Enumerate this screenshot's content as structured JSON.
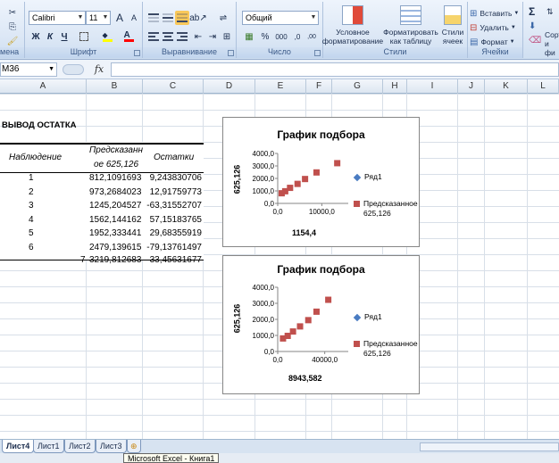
{
  "ribbon": {
    "font_group": {
      "label": "Шрифт",
      "font_name": "Calibri",
      "font_size": "11",
      "bold": "Ж",
      "italic": "К",
      "underline": "Ч",
      "grow": "A",
      "shrink": "A"
    },
    "clipboard_group": {
      "label": "мена"
    },
    "align_group": {
      "label": "Выравнивание"
    },
    "number_group": {
      "label": "Число",
      "format": "Общий",
      "percent": "%",
      "thousands": "000",
      "inc_dec": ",0",
      "dec_dec": ",00"
    },
    "styles_group": {
      "label": "Стили",
      "conditional": "Условное",
      "conditional2": "форматирование",
      "table": "Форматировать",
      "table2": "как таблицу",
      "cell_styles": "Стили",
      "cell_styles2": "ячеек"
    },
    "cells_group": {
      "label": "Ячейки",
      "insert": "Вставить",
      "delete": "Удалить",
      "format": "Формат"
    },
    "edit_group": {
      "sigma": "Σ",
      "sort": "Сорт",
      "sort2": "и фи"
    }
  },
  "formula_bar": {
    "name_box": "M36",
    "fx": "fx",
    "value": ""
  },
  "columns": [
    "A",
    "B",
    "C",
    "D",
    "E",
    "F",
    "G",
    "H",
    "I",
    "J",
    "K",
    "L"
  ],
  "table": {
    "title": "ВЫВОД ОСТАТКА",
    "headers": {
      "obs": "Наблюдение",
      "pred1": "Предсказанн",
      "pred2": "ое 625,126",
      "resid": "Остатки"
    },
    "rows": [
      {
        "n": "1",
        "pred": "812,1091693",
        "resid": "9,243830706"
      },
      {
        "n": "2",
        "pred": "973,2684023",
        "resid": "12,91759773"
      },
      {
        "n": "3",
        "pred": "1245,204527",
        "resid": "-63,31552707"
      },
      {
        "n": "4",
        "pred": "1562,144162",
        "resid": "57,15183765"
      },
      {
        "n": "5",
        "pred": "1952,333441",
        "resid": "29,68355919"
      },
      {
        "n": "6",
        "pred": "2479,139615",
        "resid": "-79,13761497"
      },
      {
        "n": "7",
        "pred": "3219,812683",
        "resid": "33,45631677"
      }
    ]
  },
  "chart_data": [
    {
      "type": "scatter",
      "title": "График подбора",
      "xlabel": "1154,4",
      "ylabel": "625,126",
      "x_ticks": [
        "0,0",
        "10000,0"
      ],
      "y_ticks": [
        "0,0",
        "1000,0",
        "2000,0",
        "3000,0",
        "4000,0"
      ],
      "ylim": [
        0,
        4000
      ],
      "xlim": [
        0,
        16000
      ],
      "legend_position": "right",
      "series": [
        {
          "name": "Ряд1",
          "color": "#4a7cc2",
          "marker": "diamond",
          "x": [],
          "y": []
        },
        {
          "name": "Предсказанное 625,126",
          "color": "#c0504d",
          "marker": "square",
          "x": [
            900,
            1700,
            2800,
            4500,
            6200,
            8800,
            13500
          ],
          "y": [
            812,
            973,
            1245,
            1562,
            1952,
            2479,
            3220
          ]
        }
      ]
    },
    {
      "type": "scatter",
      "title": "График подбора",
      "xlabel": "8943,582",
      "ylabel": "625,126",
      "x_ticks": [
        "0,0",
        "40000,0"
      ],
      "y_ticks": [
        "0,0",
        "1000,0",
        "2000,0",
        "3000,0",
        "4000,0"
      ],
      "ylim": [
        0,
        4000
      ],
      "xlim": [
        0,
        60000
      ],
      "legend_position": "right",
      "series": [
        {
          "name": "Ряд1",
          "color": "#4a7cc2",
          "marker": "diamond",
          "x": [],
          "y": []
        },
        {
          "name": "Предсказанное 625,126",
          "color": "#c0504d",
          "marker": "square",
          "x": [
            4500,
            8500,
            13000,
            19000,
            26000,
            33000,
            43000
          ],
          "y": [
            812,
            973,
            1245,
            1562,
            1952,
            2479,
            3220
          ]
        }
      ]
    }
  ],
  "sheet_tabs": [
    {
      "label": "Лист4",
      "active": true
    },
    {
      "label": "Лист1",
      "active": false
    },
    {
      "label": "Лист2",
      "active": false
    },
    {
      "label": "Лист3",
      "active": false
    }
  ],
  "tooltip": "Microsoft Excel - Книга1",
  "colors": {
    "accent_blue": "#4a7cc2",
    "accent_red": "#c0504d"
  }
}
